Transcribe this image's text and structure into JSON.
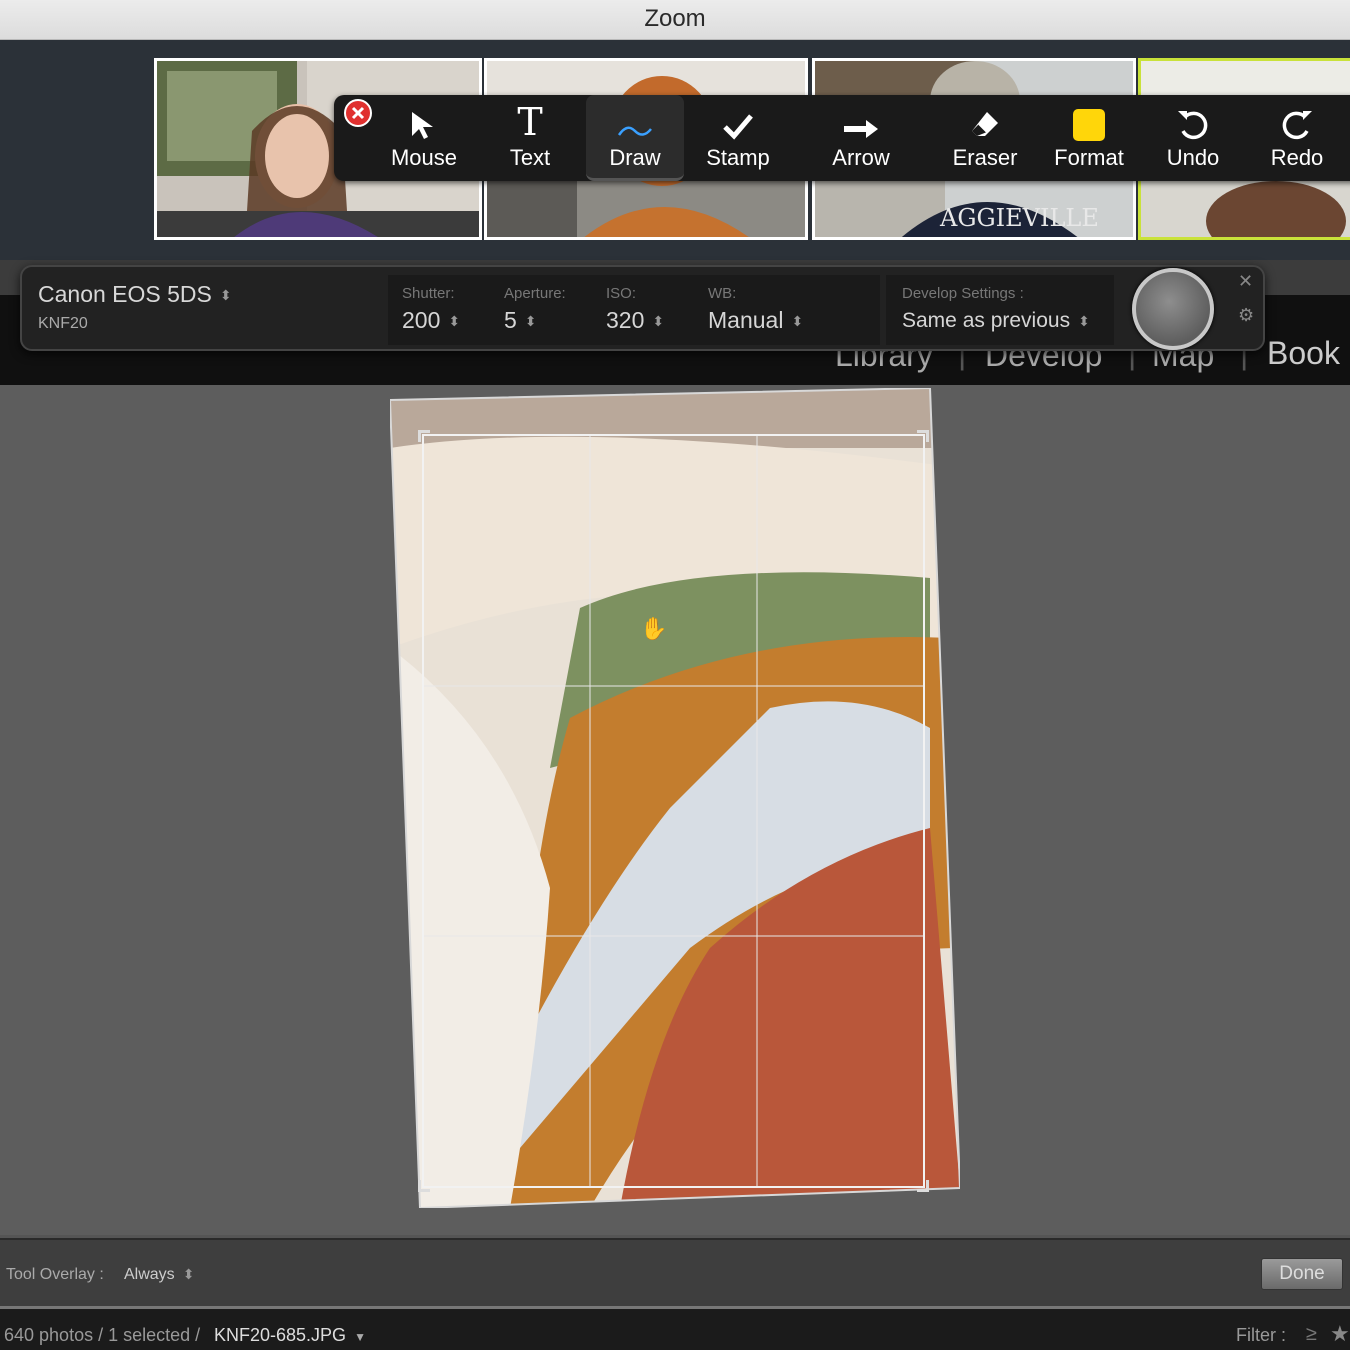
{
  "zoom": {
    "window_title": "Zoom",
    "annotation_tools": [
      {
        "label": "Mouse",
        "icon": "mouse-pointer-icon"
      },
      {
        "label": "Text",
        "icon": "text-icon"
      },
      {
        "label": "Draw",
        "icon": "draw-squiggle-icon",
        "selected": true
      },
      {
        "label": "Stamp",
        "icon": "checkmark-stamp-icon"
      },
      {
        "label": "Arrow",
        "icon": "arrow-right-icon"
      },
      {
        "label": "Eraser",
        "icon": "eraser-icon"
      },
      {
        "label": "Format",
        "icon": "format-color-icon",
        "color": "#FFD60A"
      },
      {
        "label": "Undo",
        "icon": "undo-icon"
      },
      {
        "label": "Redo",
        "icon": "redo-icon"
      }
    ],
    "video_tiles": [
      {
        "name": "participant-1"
      },
      {
        "name": "participant-2"
      },
      {
        "name": "participant-3",
        "caption": "AGGIEVILLE"
      },
      {
        "name": "participant-4",
        "active_speaker": true
      }
    ]
  },
  "tether": {
    "camera": "Canon EOS 5DS",
    "session": "KNF20",
    "shutter_label": "Shutter:",
    "shutter_value": "200",
    "aperture_label": "Aperture:",
    "aperture_value": "5",
    "iso_label": "ISO:",
    "iso_value": "320",
    "wb_label": "WB:",
    "wb_value": "Manual",
    "develop_label": "Develop Settings :",
    "develop_value": "Same as previous"
  },
  "modules": [
    "Library",
    "Develop",
    "Map",
    "Book"
  ],
  "toolbar": {
    "overlay_label": "Tool Overlay :",
    "overlay_value": "Always",
    "done_label": "Done"
  },
  "filmstrip": {
    "count_text": "640 photos / 1 selected /",
    "filename": "KNF20-685.JPG",
    "filter_label": "Filter :"
  },
  "colors": {
    "accent_active_speaker": "#c9e23a",
    "close_red": "#e0302f",
    "format_yellow": "#FFD60A"
  }
}
